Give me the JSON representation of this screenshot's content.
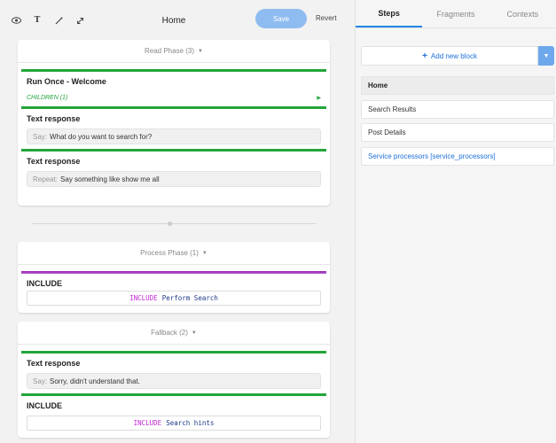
{
  "caption": "conversation_block",
  "toolbar": {
    "title": "Home",
    "save_label": "Save",
    "revert_label": "Revert"
  },
  "phases": {
    "read": {
      "header": "Read Phase (3)",
      "blocks": [
        {
          "title": "Run Once - Welcome",
          "children_label": "CHILDREN (1)"
        },
        {
          "title": "Text response",
          "prefix": "Say:",
          "text": "What do you want to search for?"
        },
        {
          "title": "Text response",
          "prefix": "Repeat:",
          "text": "Say something like show me all"
        }
      ]
    },
    "process": {
      "header": "Process Phase (1)",
      "blocks": [
        {
          "title": "INCLUDE",
          "keyword": "INCLUDE",
          "ref": "Perform Search"
        }
      ]
    },
    "fallback": {
      "header": "Fallback (2)",
      "blocks": [
        {
          "title": "Text response",
          "prefix": "Say:",
          "text": "Sorry, didn't understand that."
        },
        {
          "title": "INCLUDE",
          "keyword": "INCLUDE",
          "ref": "Search hints"
        }
      ]
    }
  },
  "panel": {
    "tabs": [
      "Steps",
      "Fragments",
      "Contexts"
    ],
    "active_tab": "Steps",
    "add_label": "Add new block",
    "steps": [
      "Home",
      "Search Results",
      "Post Details",
      "Service processors [service_processors]"
    ]
  },
  "colors": {
    "accent": "#1e88e5",
    "save": "#8fbcf0",
    "block_bar": "#22a53a",
    "include_bar": "#9c27b0"
  },
  "icons": [
    "eye-icon",
    "text-format-icon",
    "wand-icon",
    "expand-icon",
    "caret-down-icon",
    "play-arrow-icon",
    "plus-icon"
  ]
}
